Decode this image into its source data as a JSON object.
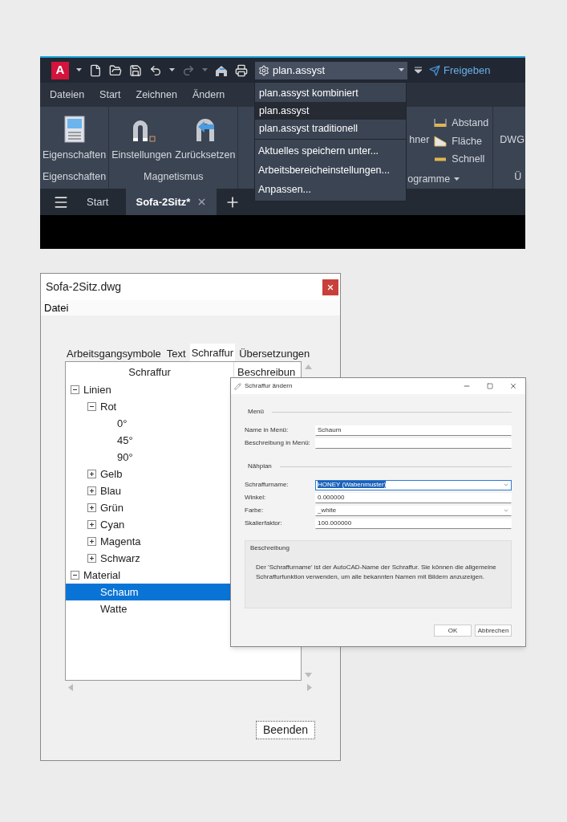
{
  "cad_window": {
    "logo": "A",
    "workspace": "plan.assyst",
    "share": "Freigeben",
    "menu_tabs": [
      "Dateien",
      "Start",
      "Zeichnen",
      "Ändern"
    ],
    "ribbon_panels": [
      {
        "title": "Eigenschaften",
        "buttons": [
          {
            "label": "Eigenschaften",
            "kind": "properties"
          }
        ]
      },
      {
        "title": "Magnetismus",
        "buttons": [
          {
            "label": "Einstellungen",
            "kind": "magnet"
          },
          {
            "label": "Zurücksetzen",
            "kind": "magnet-reset"
          }
        ]
      }
    ],
    "ribbon_partial": {
      "button": "hner",
      "panel_title": "ogramme",
      "tools": [
        {
          "label": "Abstand",
          "kind": "distance"
        },
        {
          "label": "Fläche",
          "kind": "area"
        },
        {
          "label": "Schnell",
          "kind": "quick"
        }
      ],
      "next_button": "DWG",
      "next_panel_title": "Ü"
    },
    "workspace_menu": {
      "items": [
        {
          "label": "plan.assyst kombiniert",
          "selected": false
        },
        {
          "label": "plan.assyst",
          "selected": true
        },
        {
          "label": "plan.assyst traditionell",
          "selected": false
        }
      ],
      "actions": [
        "Aktuelles speichern unter...",
        "Arbeitsbereicheinstellungen...",
        "Anpassen..."
      ]
    },
    "file_tabs": [
      {
        "label": "Start",
        "selected": false,
        "closable": false
      },
      {
        "label": "Sofa-2Sitz*",
        "selected": true,
        "closable": true
      }
    ]
  },
  "hatch_window": {
    "title": "Sofa-2Sitz.dwg",
    "menu": [
      "Datei"
    ],
    "tabs": [
      {
        "label": "Arbeitsgangsymbole",
        "selected": false
      },
      {
        "label": "Text",
        "selected": false
      },
      {
        "label": "Schraffur",
        "selected": true
      },
      {
        "label": "Übersetzungen",
        "selected": false
      }
    ],
    "columns": [
      "Schraffur",
      "Beschreibun"
    ],
    "tree": [
      {
        "label": "Linien",
        "expanded": true,
        "selected": false,
        "children": [
          {
            "label": "Rot",
            "expanded": true,
            "selected": false,
            "children": [
              {
                "label": "0°",
                "selected": false
              },
              {
                "label": "45°",
                "selected": false
              },
              {
                "label": "90°",
                "selected": false
              }
            ]
          },
          {
            "label": "Gelb",
            "expanded": false,
            "selected": false
          },
          {
            "label": "Blau",
            "expanded": false,
            "selected": false
          },
          {
            "label": "Grün",
            "expanded": false,
            "selected": false
          },
          {
            "label": "Cyan",
            "expanded": false,
            "selected": false
          },
          {
            "label": "Magenta",
            "expanded": false,
            "selected": false
          },
          {
            "label": "Schwarz",
            "expanded": false,
            "selected": false
          }
        ]
      },
      {
        "label": "Material",
        "expanded": true,
        "selected": false,
        "children": [
          {
            "label": "Schaum",
            "selected": true
          },
          {
            "label": "Watte",
            "selected": false
          }
        ]
      }
    ],
    "button": "Beenden"
  },
  "edit_dialog": {
    "title": "Schraffur ändern",
    "sections": [
      {
        "title": "Menü",
        "fields": [
          {
            "label": "Name in Menü:",
            "kind": "text",
            "value": "Schaum",
            "focused": false
          },
          {
            "label": "Beschreibung in Menü:",
            "kind": "text",
            "focused": false
          }
        ]
      },
      {
        "title": "Nähplan",
        "fields": [
          {
            "label": "Schraffurname:",
            "kind": "select",
            "value": "HONEY (Wabenmuster)",
            "focused": true
          },
          {
            "label": "Winkel:",
            "kind": "text",
            "value": "0.000000",
            "focused": false
          },
          {
            "label": "Farbe:",
            "kind": "select",
            "value": "_white",
            "focused": false
          },
          {
            "label": "Skalierfaktor:",
            "kind": "text",
            "value": "100.000000",
            "focused": false
          }
        ]
      }
    ],
    "description": {
      "title": "Beschreibung",
      "text": "Der 'Schraffurname' ist der AutoCAD-Name der Schraffur. Sie können die allgemeine Schraffurfunktion verwenden, um alle bekannten Namen mit Bildern anzuzeigen."
    },
    "buttons": [
      "OK",
      "Abbrechen"
    ]
  }
}
